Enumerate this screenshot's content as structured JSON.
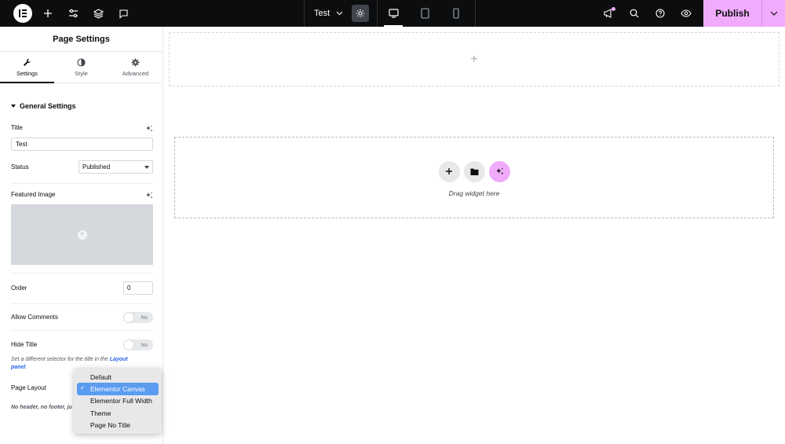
{
  "topbar": {
    "doc_title": "Test",
    "publish_label": "Publish"
  },
  "panel": {
    "header": "Page Settings",
    "tabs": [
      {
        "label": "Settings"
      },
      {
        "label": "Style"
      },
      {
        "label": "Advanced"
      }
    ],
    "section": "General Settings",
    "title_label": "Title",
    "title_value": "Test",
    "status_label": "Status",
    "status_value": "Published",
    "featured_label": "Featured Image",
    "order_label": "Order",
    "order_value": "0",
    "comments_label": "Allow Comments",
    "comments_toggle": "No",
    "hide_title_label": "Hide Title",
    "hide_title_toggle": "No",
    "hide_title_help_1": "Set a different selector for the title in the ",
    "hide_title_help_link_1": "Layout",
    "hide_title_help_link_2": "panel",
    "hide_title_help_end": ".",
    "page_layout_label": "Page Layout",
    "page_layout_help": "No header, no footer, ju"
  },
  "dropdown": {
    "options": [
      "Default",
      "Elementor Canvas",
      "Elementor Full Width",
      "Theme",
      "Page No Title"
    ],
    "selected": "Elementor Canvas",
    "check": "✓"
  },
  "canvas": {
    "plus": "+",
    "drag_text": "Drag widget here"
  },
  "colors": {
    "accent": "#f0abfc",
    "topbar": "#0c0d0e",
    "link": "#2563eb",
    "selected": "#5b9bf0"
  }
}
